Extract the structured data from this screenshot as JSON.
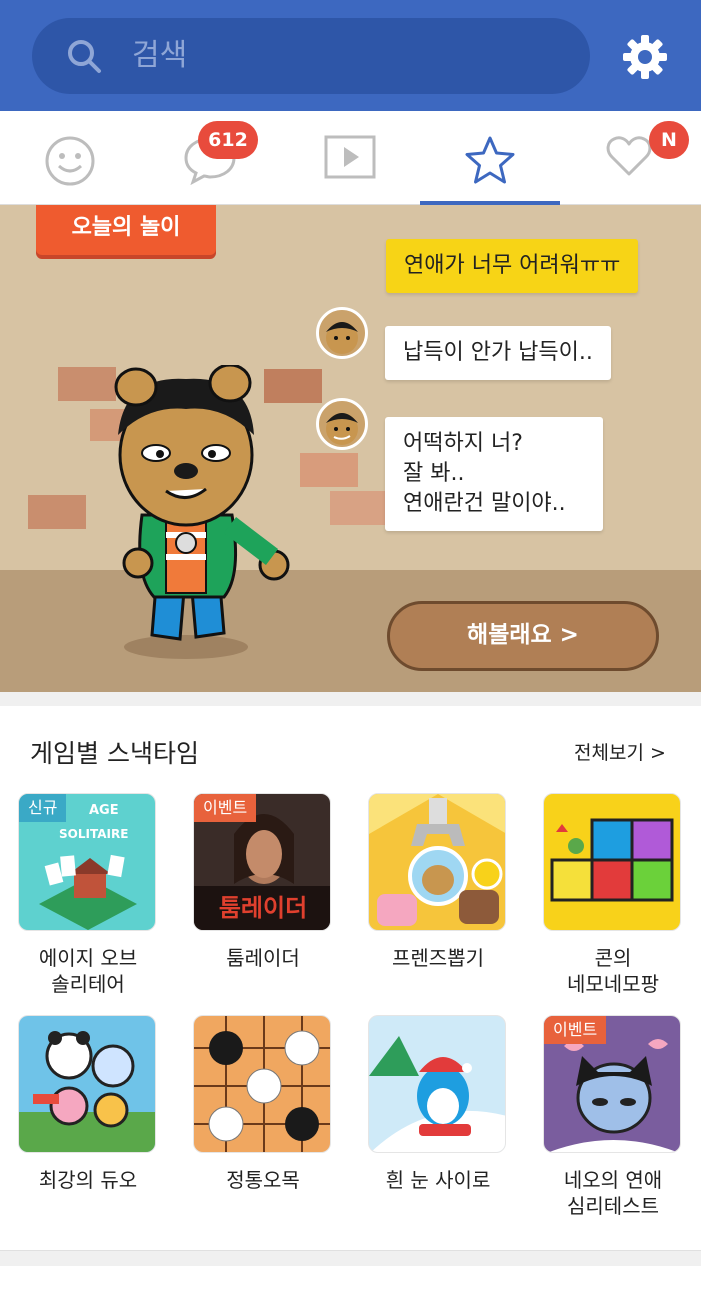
{
  "search": {
    "placeholder": "검색"
  },
  "tabs": [
    {
      "name": "emoticon",
      "icon": "smiley-icon"
    },
    {
      "name": "chat",
      "icon": "speech-bubble-icon",
      "badge": "612"
    },
    {
      "name": "video",
      "icon": "play-icon"
    },
    {
      "name": "play",
      "icon": "star-icon",
      "active": true
    },
    {
      "name": "like",
      "icon": "heart-icon",
      "badge": "N"
    }
  ],
  "banner": {
    "label": "오늘의 놀이",
    "messages": [
      {
        "text": "연애가 너무 어려워ㅠㅠ",
        "style": "yellow"
      },
      {
        "text": "납득이 안가 납득이..",
        "style": "white"
      },
      {
        "text": "어떡하지 너?\n잘 봐..\n연애란건 말이야..",
        "style": "white"
      }
    ],
    "cta": "해볼래요 >"
  },
  "section": {
    "title": "게임별 스낵타임",
    "see_all": "전체보기 >",
    "games": [
      {
        "name": "에이지 오브\n솔리테어",
        "tag": "신규",
        "thumb_text": "AGE OF\nSOLITAIRE",
        "color": "#5ed1cf"
      },
      {
        "name": "툼레이더",
        "tag": "이벤트",
        "thumb_text": "툼레이더",
        "color": "#3a2c28"
      },
      {
        "name": "프렌즈뽑기",
        "tag": "",
        "thumb_text": "",
        "color": "#f6c53b"
      },
      {
        "name": "콘의\n네모네모팡",
        "tag": "",
        "thumb_text": "",
        "color": "#f8d21a"
      },
      {
        "name": "최강의 듀오",
        "tag": "",
        "thumb_text": "",
        "color": "#6fc3e8"
      },
      {
        "name": "정통오목",
        "tag": "",
        "thumb_text": "",
        "color": "#f0a760"
      },
      {
        "name": "흰 눈 사이로",
        "tag": "",
        "thumb_text": "",
        "color": "#cfeaf8"
      },
      {
        "name": "네오의 연애\n심리테스트",
        "tag": "이벤트",
        "thumb_text": "",
        "color": "#7a5d9e"
      }
    ]
  },
  "colors": {
    "header": "#3d68c0",
    "badge": "#e84b3c",
    "accent": "#ef5b2f"
  }
}
